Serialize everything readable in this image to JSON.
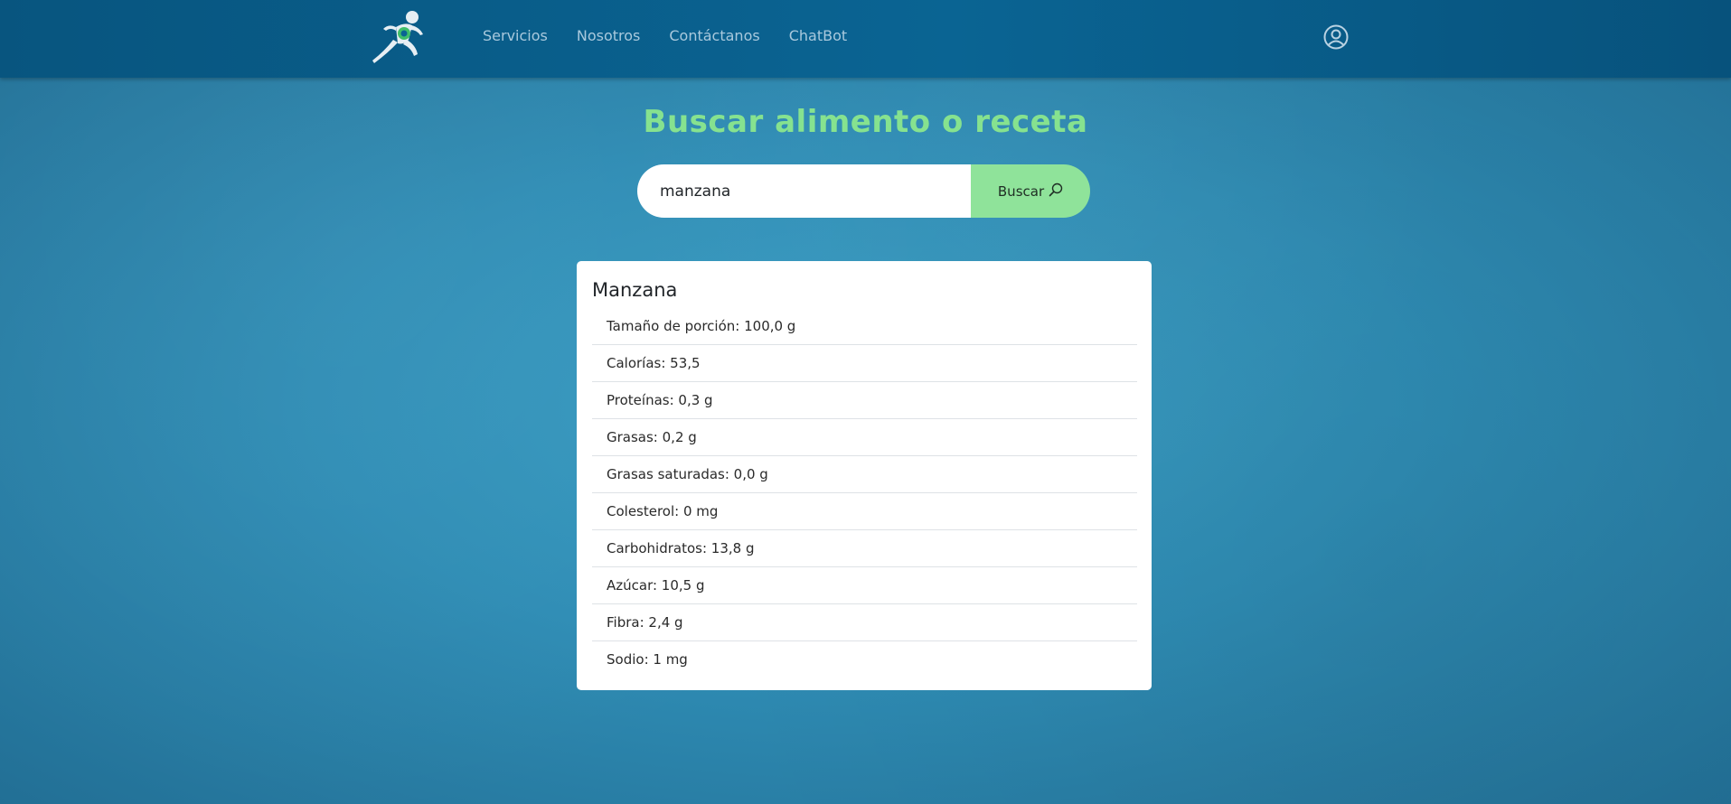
{
  "nav": {
    "links": [
      "Servicios",
      "Nosotros",
      "Contáctanos",
      "ChatBot"
    ]
  },
  "icons": {
    "logo": "runner-logo-icon",
    "user": "user-circle-icon",
    "search": "search-icon"
  },
  "colors": {
    "accent_green": "#86e28f",
    "button_green": "#8fe39a",
    "nav_bg": "#0a6493",
    "page_bg": "#2f8db5"
  },
  "page": {
    "title": "Buscar alimento o receta"
  },
  "search": {
    "value": "manzana",
    "button_label": "Buscar"
  },
  "result": {
    "name": "Manzana",
    "nutrients": [
      "Tamaño de porción: 100,0 g",
      "Calorías: 53,5",
      "Proteínas: 0,3 g",
      "Grasas: 0,2 g",
      "Grasas saturadas: 0,0 g",
      "Colesterol: 0 mg",
      "Carbohidratos: 13,8 g",
      "Azúcar: 10,5 g",
      "Fibra: 2,4 g",
      "Sodio: 1 mg"
    ]
  }
}
